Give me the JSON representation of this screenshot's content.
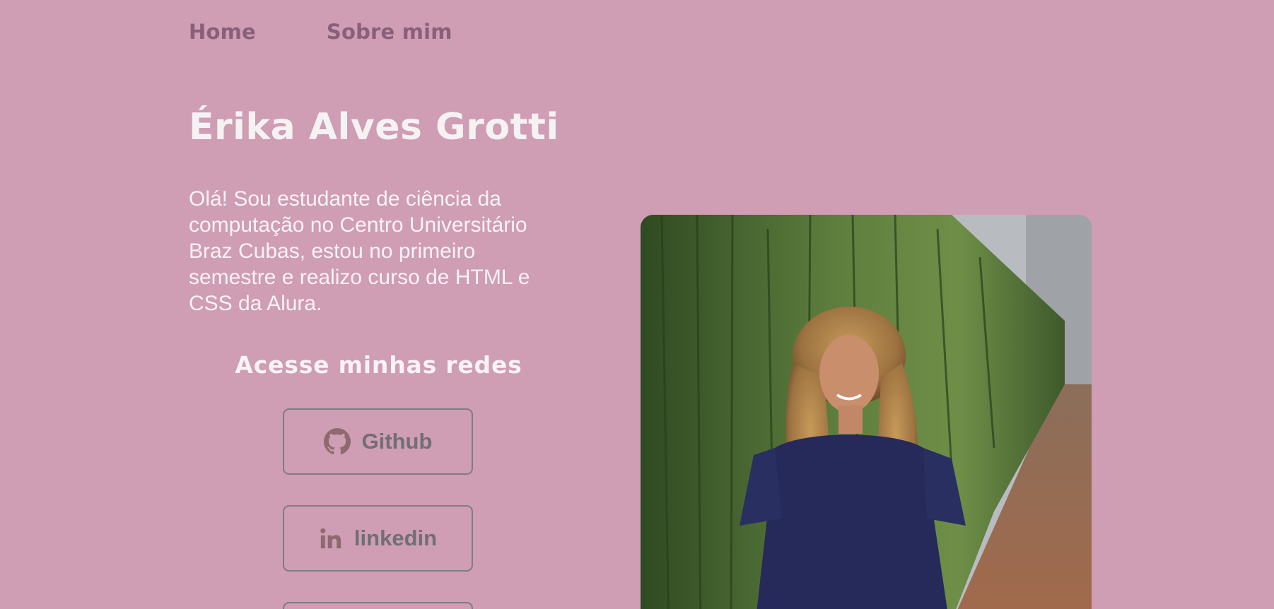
{
  "nav": {
    "items": [
      {
        "label": "Home"
      },
      {
        "label": "Sobre mim"
      }
    ]
  },
  "profile": {
    "name": "Érika Alves Grotti",
    "bio": "Olá! Sou estudante de ciência da computação no Centro Universitário Braz Cubas, estou no primeiro semestre e realizo curso de HTML e CSS da Alura."
  },
  "social": {
    "heading": "Acesse minhas redes",
    "buttons": [
      {
        "label": "Github",
        "icon": "github-icon"
      },
      {
        "label": "linkedin",
        "icon": "linkedin-icon"
      }
    ]
  },
  "colors": {
    "background": "#cf9db4",
    "nav_text": "#8a5f78",
    "heading_text": "#f5f2f4",
    "button_border": "#7d7d85",
    "button_text": "#6f6f74",
    "icon_color": "#8e6a6e"
  }
}
